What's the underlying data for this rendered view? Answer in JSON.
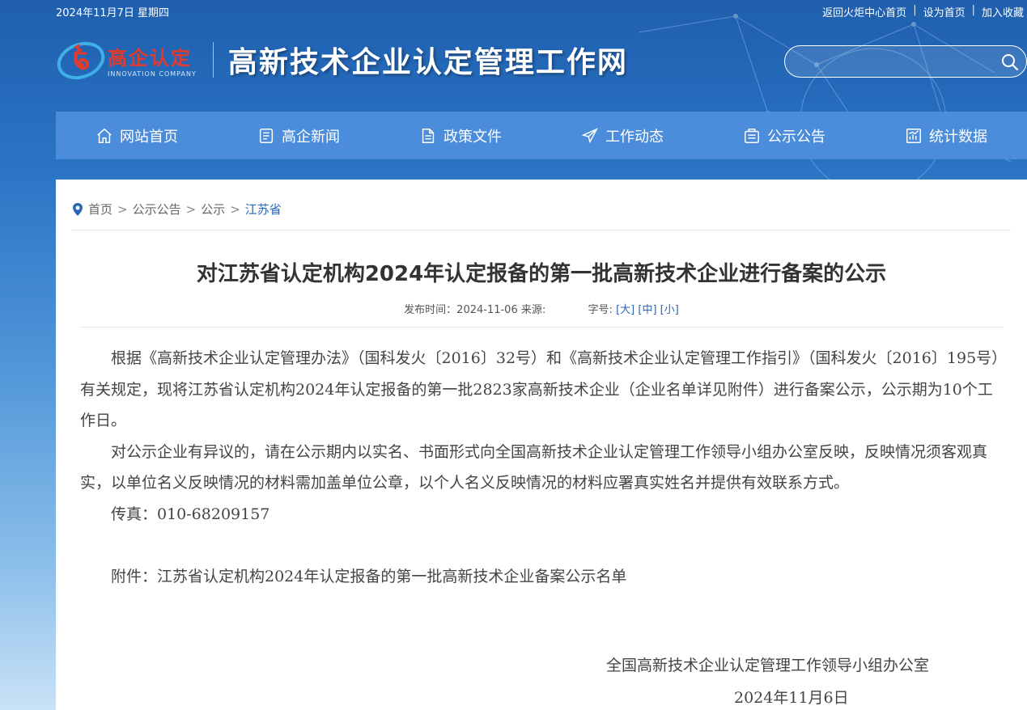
{
  "topbar": {
    "date": "2024年11月7日 星期四",
    "links": [
      "返回火炬中心首页",
      "设为首页",
      "加入收藏"
    ]
  },
  "logo": {
    "cn": "高企认定",
    "en": "INNOVATION COMPANY"
  },
  "site_title": "高新技术企业认定管理工作网",
  "search": {
    "value": "",
    "icon": "search-icon"
  },
  "nav": [
    {
      "label": "网站首页",
      "icon": "home-icon"
    },
    {
      "label": "高企新闻",
      "icon": "news-icon"
    },
    {
      "label": "政策文件",
      "icon": "document-icon"
    },
    {
      "label": "工作动态",
      "icon": "send-icon"
    },
    {
      "label": "公示公告",
      "icon": "notice-icon"
    },
    {
      "label": "统计数据",
      "icon": "chart-icon"
    }
  ],
  "breadcrumb": [
    "首页",
    "公示公告",
    "公示",
    "江苏省"
  ],
  "article": {
    "title": "对江苏省认定机构2024年认定报备的第一批高新技术企业进行备案的公示",
    "publish_label": "发布时间：",
    "publish_date": "2024-11-06",
    "source_label": "来源:",
    "font_label": "字号:",
    "font_sizes": [
      "[大]",
      "[中]",
      "[小]"
    ],
    "paragraphs": [
      "根据《高新技术企业认定管理办法》（国科发火〔2016〕32号）和《高新技术企业认定管理工作指引》（国科发火〔2016〕195号）有关规定，现将江苏省认定机构2024年认定报备的第一批2823家高新技术企业（企业名单详见附件）进行备案公示，公示期为10个工作日。",
      "对公示企业有异议的，请在公示期内以实名、书面形式向全国高新技术企业认定管理工作领导小组办公室反映，反映情况须客观真实，以单位名义反映情况的材料需加盖单位公章，以个人名义反映情况的材料应署真实姓名并提供有效联系方式。",
      "传真：010-68209157"
    ],
    "attachment": "附件：江苏省认定机构2024年认定报备的第一批高新技术企业备案公示名单",
    "signature": "全国高新技术企业认定管理工作领导小组办公室",
    "sign_date": "2024年11月6日"
  }
}
